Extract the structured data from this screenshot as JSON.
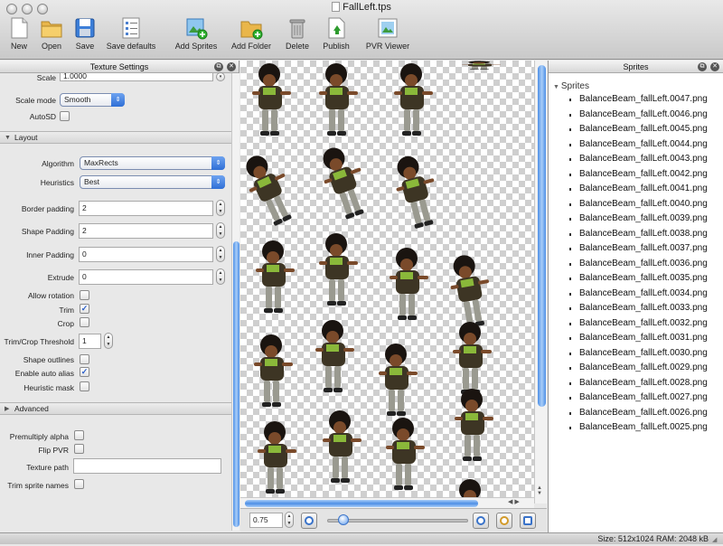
{
  "window": {
    "title": "FallLeft.tps"
  },
  "toolbar": {
    "new": "New",
    "open": "Open",
    "save": "Save",
    "save_defaults": "Save defaults",
    "add_sprites": "Add Sprites",
    "add_folder": "Add Folder",
    "delete": "Delete",
    "publish": "Publish",
    "pvr_viewer": "PVR Viewer"
  },
  "texture_settings": {
    "title": "Texture Settings",
    "scale_label": "Scale",
    "scale_value": "1.0000",
    "scale_mode_label": "Scale mode",
    "scale_mode_value": "Smooth",
    "autosd_label": "AutoSD",
    "layout_section": "Layout",
    "algorithm_label": "Algorithm",
    "algorithm_value": "MaxRects",
    "heuristics_label": "Heuristics",
    "heuristics_value": "Best",
    "border_padding_label": "Border padding",
    "border_padding_value": "2",
    "shape_padding_label": "Shape Padding",
    "shape_padding_value": "2",
    "inner_padding_label": "Inner Padding",
    "inner_padding_value": "0",
    "extrude_label": "Extrude",
    "extrude_value": "0",
    "allow_rotation_label": "Allow rotation",
    "trim_label": "Trim",
    "crop_label": "Crop",
    "threshold_label": "Trim/Crop Threshold",
    "threshold_value": "1",
    "shape_outlines_label": "Shape outlines",
    "auto_alias_label": "Enable auto alias",
    "heuristic_mask_label": "Heuristic mask",
    "advanced_section": "Advanced",
    "premultiply_label": "Premultiply alpha",
    "flip_pvr_label": "Flip PVR",
    "texture_path_label": "Texture path",
    "texture_path_value": "",
    "trim_names_label": "Trim sprite names",
    "checks": {
      "autosd": false,
      "allow_rotation": false,
      "trim": true,
      "crop": false,
      "shape_outlines": false,
      "auto_alias": true,
      "heuristic_mask": false,
      "premultiply": false,
      "flip_pvr": false,
      "trim_names": false
    }
  },
  "preview": {
    "zoom_value": "0.75",
    "zoom_level": 0.08
  },
  "sprites_panel": {
    "title": "Sprites",
    "group": "Sprites",
    "items": [
      "BalanceBeam_fallLeft.0047.png",
      "BalanceBeam_fallLeft.0046.png",
      "BalanceBeam_fallLeft.0045.png",
      "BalanceBeam_fallLeft.0044.png",
      "BalanceBeam_fallLeft.0043.png",
      "BalanceBeam_fallLeft.0042.png",
      "BalanceBeam_fallLeft.0041.png",
      "BalanceBeam_fallLeft.0040.png",
      "BalanceBeam_fallLeft.0039.png",
      "BalanceBeam_fallLeft.0038.png",
      "BalanceBeam_fallLeft.0037.png",
      "BalanceBeam_fallLeft.0036.png",
      "BalanceBeam_fallLeft.0035.png",
      "BalanceBeam_fallLeft.0034.png",
      "BalanceBeam_fallLeft.0033.png",
      "BalanceBeam_fallLeft.0032.png",
      "BalanceBeam_fallLeft.0031.png",
      "BalanceBeam_fallLeft.0030.png",
      "BalanceBeam_fallLeft.0029.png",
      "BalanceBeam_fallLeft.0028.png",
      "BalanceBeam_fallLeft.0027.png",
      "BalanceBeam_fallLeft.0026.png",
      "BalanceBeam_fallLeft.0025.png"
    ]
  },
  "status": {
    "text": "Size: 512x1024 RAM: 2048 kB"
  },
  "icons": [
    "document-icon",
    "folder-icon",
    "floppy-icon",
    "checklist-icon",
    "add-sprites-icon",
    "add-folder-icon",
    "trash-icon",
    "publish-icon",
    "pvr-viewer-icon",
    "zoom-in-icon",
    "zoom-out-icon",
    "zoom-fit-icon",
    "close-icon",
    "detach-icon"
  ],
  "colors": {
    "accent": "#3a73c9",
    "selection_blue": "#5f9cec"
  }
}
